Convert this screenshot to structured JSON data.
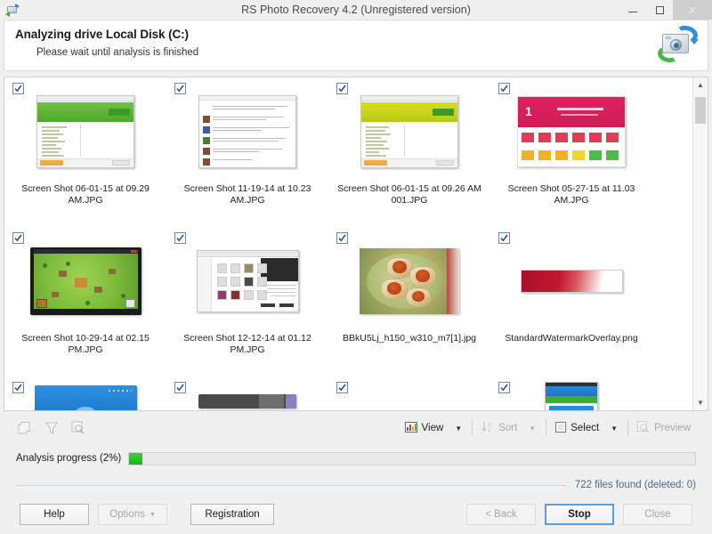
{
  "window": {
    "title": "RS Photo Recovery 4.2 (Unregistered version)",
    "app_icon": "camera-recovery-icon",
    "controls": {
      "minimize": "minimize-icon",
      "maximize": "maximize-icon",
      "close": "✕"
    }
  },
  "header": {
    "title": "Analyzing drive Local Disk (C:)",
    "subtitle": "Please wait until analysis is finished",
    "icon": "camera-recovery-icon"
  },
  "thumbnails": {
    "rows": [
      [
        {
          "name": "Screen Shot 06-01-15 at 09.29 AM.JPG",
          "checked": true,
          "art": "app-green"
        },
        {
          "name": "Screen Shot 11-19-14 at 10.23 AM.JPG",
          "checked": true,
          "art": "forum"
        },
        {
          "name": "Screen Shot 06-01-15 at 09.26 AM 001.JPG",
          "checked": true,
          "art": "app-yellow"
        },
        {
          "name": "Screen Shot 05-27-15 at 11.03 AM.JPG",
          "checked": true,
          "art": "pink-dashboard"
        }
      ],
      [
        {
          "name": "Screen Shot 10-29-14 at 02.15 PM.JPG",
          "checked": true,
          "art": "game"
        },
        {
          "name": "Screen Shot 12-12-14 at 01.12 PM.JPG",
          "checked": true,
          "art": "browser"
        },
        {
          "name": "BBkU5Lj_h150_w310_m7[1].jpg",
          "checked": true,
          "art": "food"
        },
        {
          "name": "StandardWatermarkOverlay.png",
          "checked": true,
          "art": "watermark"
        }
      ],
      [
        {
          "name": "",
          "checked": true,
          "art": "blue-bar"
        },
        {
          "name": "",
          "checked": true,
          "art": "dark-bar"
        },
        {
          "name": "",
          "checked": true,
          "art": "mobile"
        },
        {
          "name": "",
          "checked": true,
          "art": "none"
        }
      ]
    ]
  },
  "toolbar": {
    "left_icons": [
      {
        "name": "copy-pages-icon",
        "enabled": false
      },
      {
        "name": "filter-funnel-icon",
        "enabled": false
      },
      {
        "name": "find-magnifier-icon",
        "enabled": false
      }
    ],
    "view_label": "View",
    "sort_label": "Sort",
    "select_label": "Select",
    "preview_label": "Preview",
    "dropdown_caret": "▼"
  },
  "progress": {
    "label": "Analysis progress (2%)",
    "percent": 2,
    "fill_color": "#17b717"
  },
  "status": {
    "files_found": "722 files found (deleted: 0)",
    "text_color": "#4a6b8a"
  },
  "footer": {
    "help": "Help",
    "options": "Options",
    "options_caret": "▼",
    "registration": "Registration",
    "back": "< Back",
    "stop": "Stop",
    "close": "Close"
  }
}
